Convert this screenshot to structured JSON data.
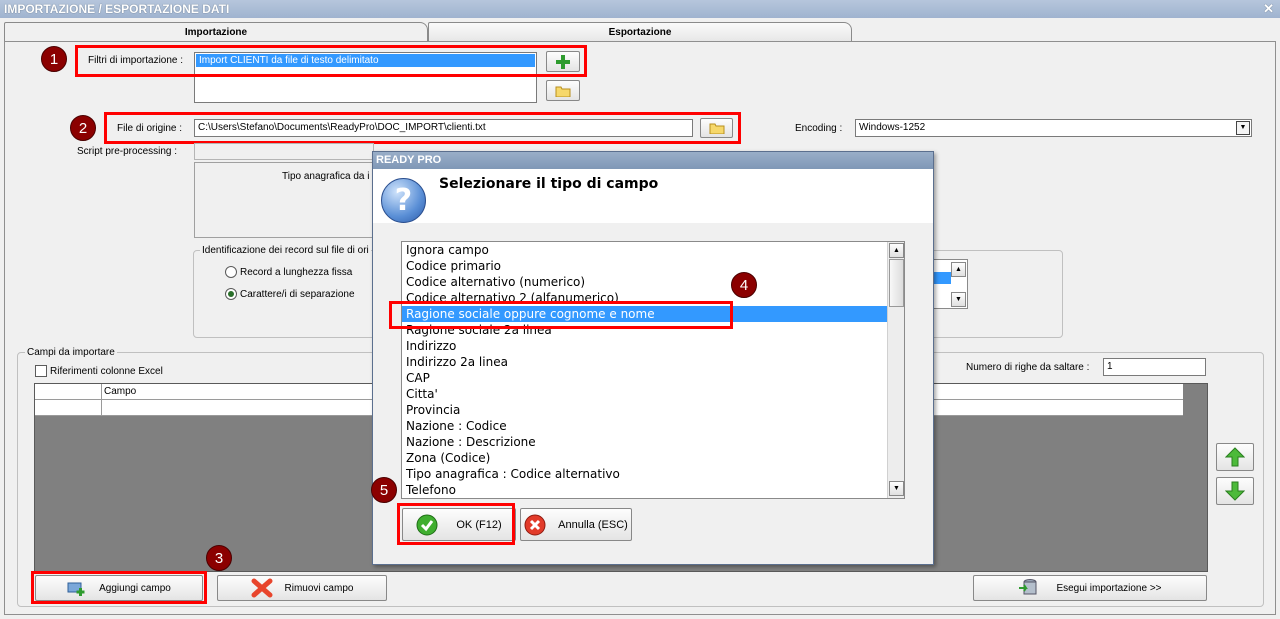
{
  "window": {
    "title": "IMPORTAZIONE / ESPORTAZIONE DATI",
    "close_glyph": "✕"
  },
  "tabs": [
    {
      "label": "Importazione",
      "active": true
    },
    {
      "label": "Esportazione",
      "active": false
    }
  ],
  "form": {
    "filtri_label": "Filtri di importazione :",
    "filtri_selected": "Import CLIENTI da file di testo delimitato",
    "file_origine_label": "File di origine :",
    "file_origine_value": "C:\\Users\\Stefano\\Documents\\ReadyPro\\DOC_IMPORT\\clienti.txt",
    "encoding_label": "Encoding :",
    "encoding_value": "Windows-1252",
    "script_label": "Script pre-processing :",
    "tipo_anagrafica_label": "Tipo anagrafica da i",
    "identificazione_label": "Identificazione dei record sul file di ori",
    "radio_fixed": "Record a lunghezza fissa",
    "radio_separator": "Carattere/i di separazione",
    "radio_selected": "separator"
  },
  "campi": {
    "group_label": "Campi da importare",
    "excel_label": "Riferimenti colonne Excel",
    "righe_label": "Numero di righe da saltare :",
    "righe_value": "1",
    "column_header": "Campo",
    "add_button": "Aggiungi campo",
    "remove_button": "Rimuovi campo",
    "run_button": "Esegui importazione >>"
  },
  "callouts": [
    "1",
    "2",
    "3",
    "4",
    "5"
  ],
  "dialog": {
    "title": "READY PRO",
    "heading": "Selezionare il tipo di campo",
    "items": [
      "Ignora campo",
      "Codice primario",
      "Codice alternativo (numerico)",
      "Codice alternativo 2 (alfanumerico)",
      "Ragione sociale oppure cognome e nome",
      "Ragione sociale 2a linea",
      "Indirizzo",
      "Indirizzo 2a linea",
      "CAP",
      "Citta'",
      "Provincia",
      "Nazione : Codice",
      "Nazione : Descrizione",
      "Zona (Codice)",
      "Tipo anagrafica : Codice alternativo",
      "Telefono"
    ],
    "selected_index": 4,
    "ok_button": "OK (F12)",
    "cancel_button": "Annulla (ESC)"
  },
  "colors": {
    "highlight": "#3399ff",
    "callout": "#8b0000",
    "annotation": "#ff0000"
  }
}
